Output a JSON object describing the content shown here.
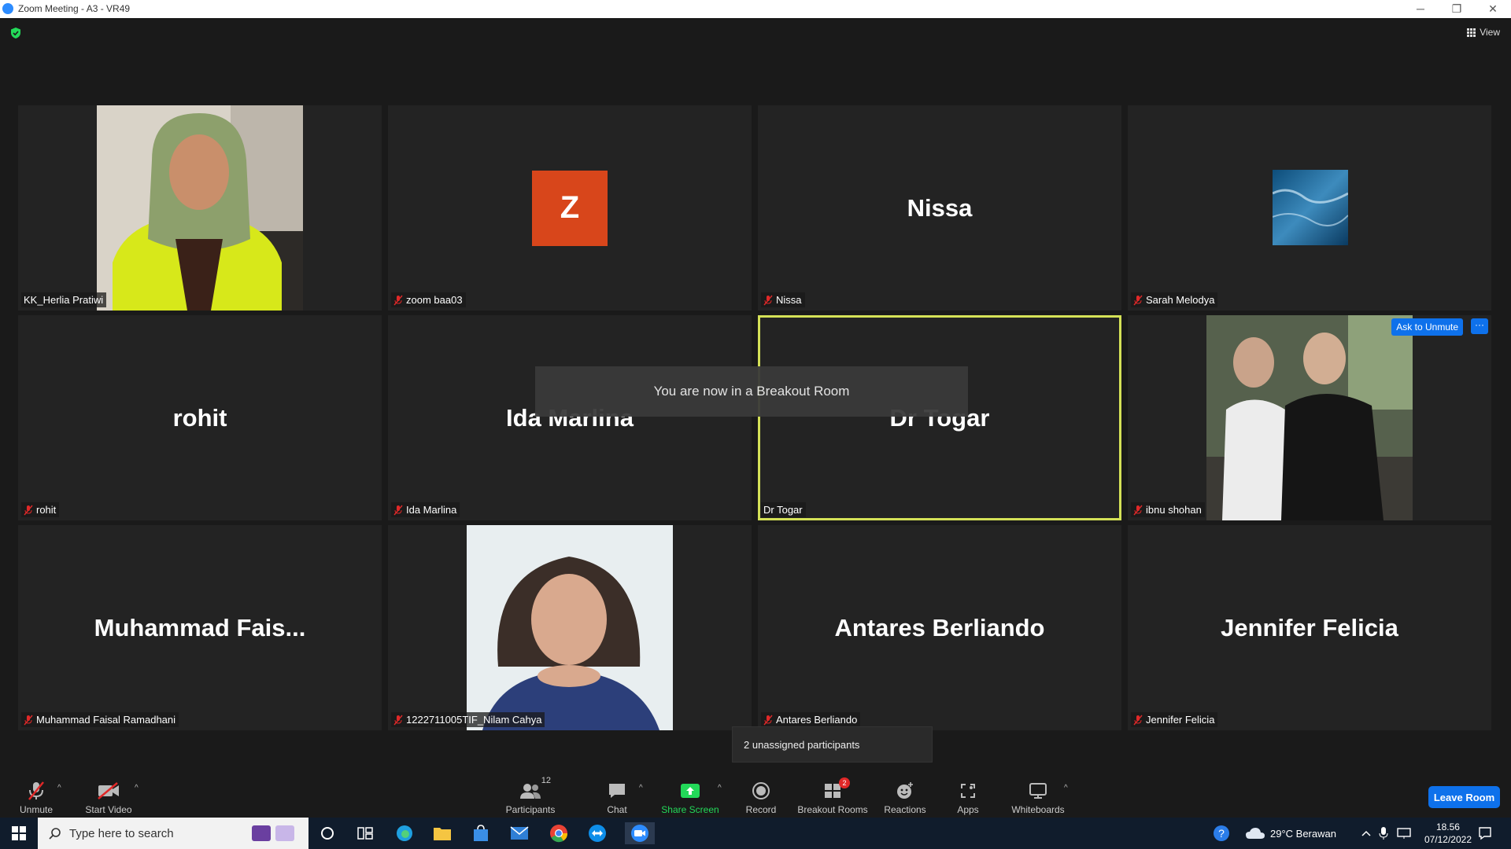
{
  "window": {
    "title": "Zoom Meeting - A3 - VR49",
    "minimize_icon": "─",
    "restore_icon": "❐",
    "close_icon": "✕"
  },
  "top": {
    "view_label": "View"
  },
  "tiles": [
    {
      "label": "KK_Herlia Pratiwi",
      "muted": false,
      "type": "photo"
    },
    {
      "label": "zoom baa03",
      "muted": true,
      "type": "avatar",
      "avatar_letter": "Z",
      "avatar_color": "#d8461b"
    },
    {
      "label": "Nissa",
      "muted": true,
      "type": "name",
      "big_name": "Nissa"
    },
    {
      "label": "Sarah Melodya",
      "muted": true,
      "type": "image"
    },
    {
      "label": "rohit",
      "muted": true,
      "type": "name",
      "big_name": "rohit"
    },
    {
      "label": "Ida Marlina",
      "muted": true,
      "type": "name",
      "big_name": "Ida Marlina"
    },
    {
      "label": "Dr Togar",
      "muted": false,
      "type": "name",
      "big_name": "Dr Togar",
      "active": true
    },
    {
      "label": "ibnu shohan",
      "muted": true,
      "type": "photo",
      "ask_to_unmute": "Ask to Unmute",
      "more": "···"
    },
    {
      "label": "Muhammad Faisal Ramadhani",
      "muted": true,
      "type": "name",
      "big_name": "Muhammad  Fais..."
    },
    {
      "label": "1222711005TIF_Nilam Cahya",
      "muted": true,
      "type": "photo"
    },
    {
      "label": "Antares Berliando",
      "muted": true,
      "type": "name",
      "big_name": "Antares Berliando"
    },
    {
      "label": "Jennifer Felicia",
      "muted": true,
      "type": "name",
      "big_name": "Jennifer Felicia"
    }
  ],
  "notifications": {
    "breakout_toast": "You are now in a Breakout Room",
    "unassigned": "2 unassigned participants"
  },
  "toolbar": {
    "unmute": "Unmute",
    "start_video": "Start Video",
    "participants": "Participants",
    "participants_count": "12",
    "chat": "Chat",
    "share_screen": "Share Screen",
    "record": "Record",
    "breakout_rooms": "Breakout Rooms",
    "breakout_badge": "2",
    "reactions": "Reactions",
    "apps": "Apps",
    "whiteboards": "Whiteboards",
    "leave_room": "Leave Room",
    "caret": "^"
  },
  "taskbar": {
    "search_placeholder": "Type here to search",
    "weather": "29°C  Berawan",
    "time": "18.56",
    "date": "07/12/2022"
  },
  "colors": {
    "accent_blue": "#0e71eb",
    "active_speaker": "#d4e157",
    "share_green": "#23d959",
    "mute_red": "#e02828"
  }
}
